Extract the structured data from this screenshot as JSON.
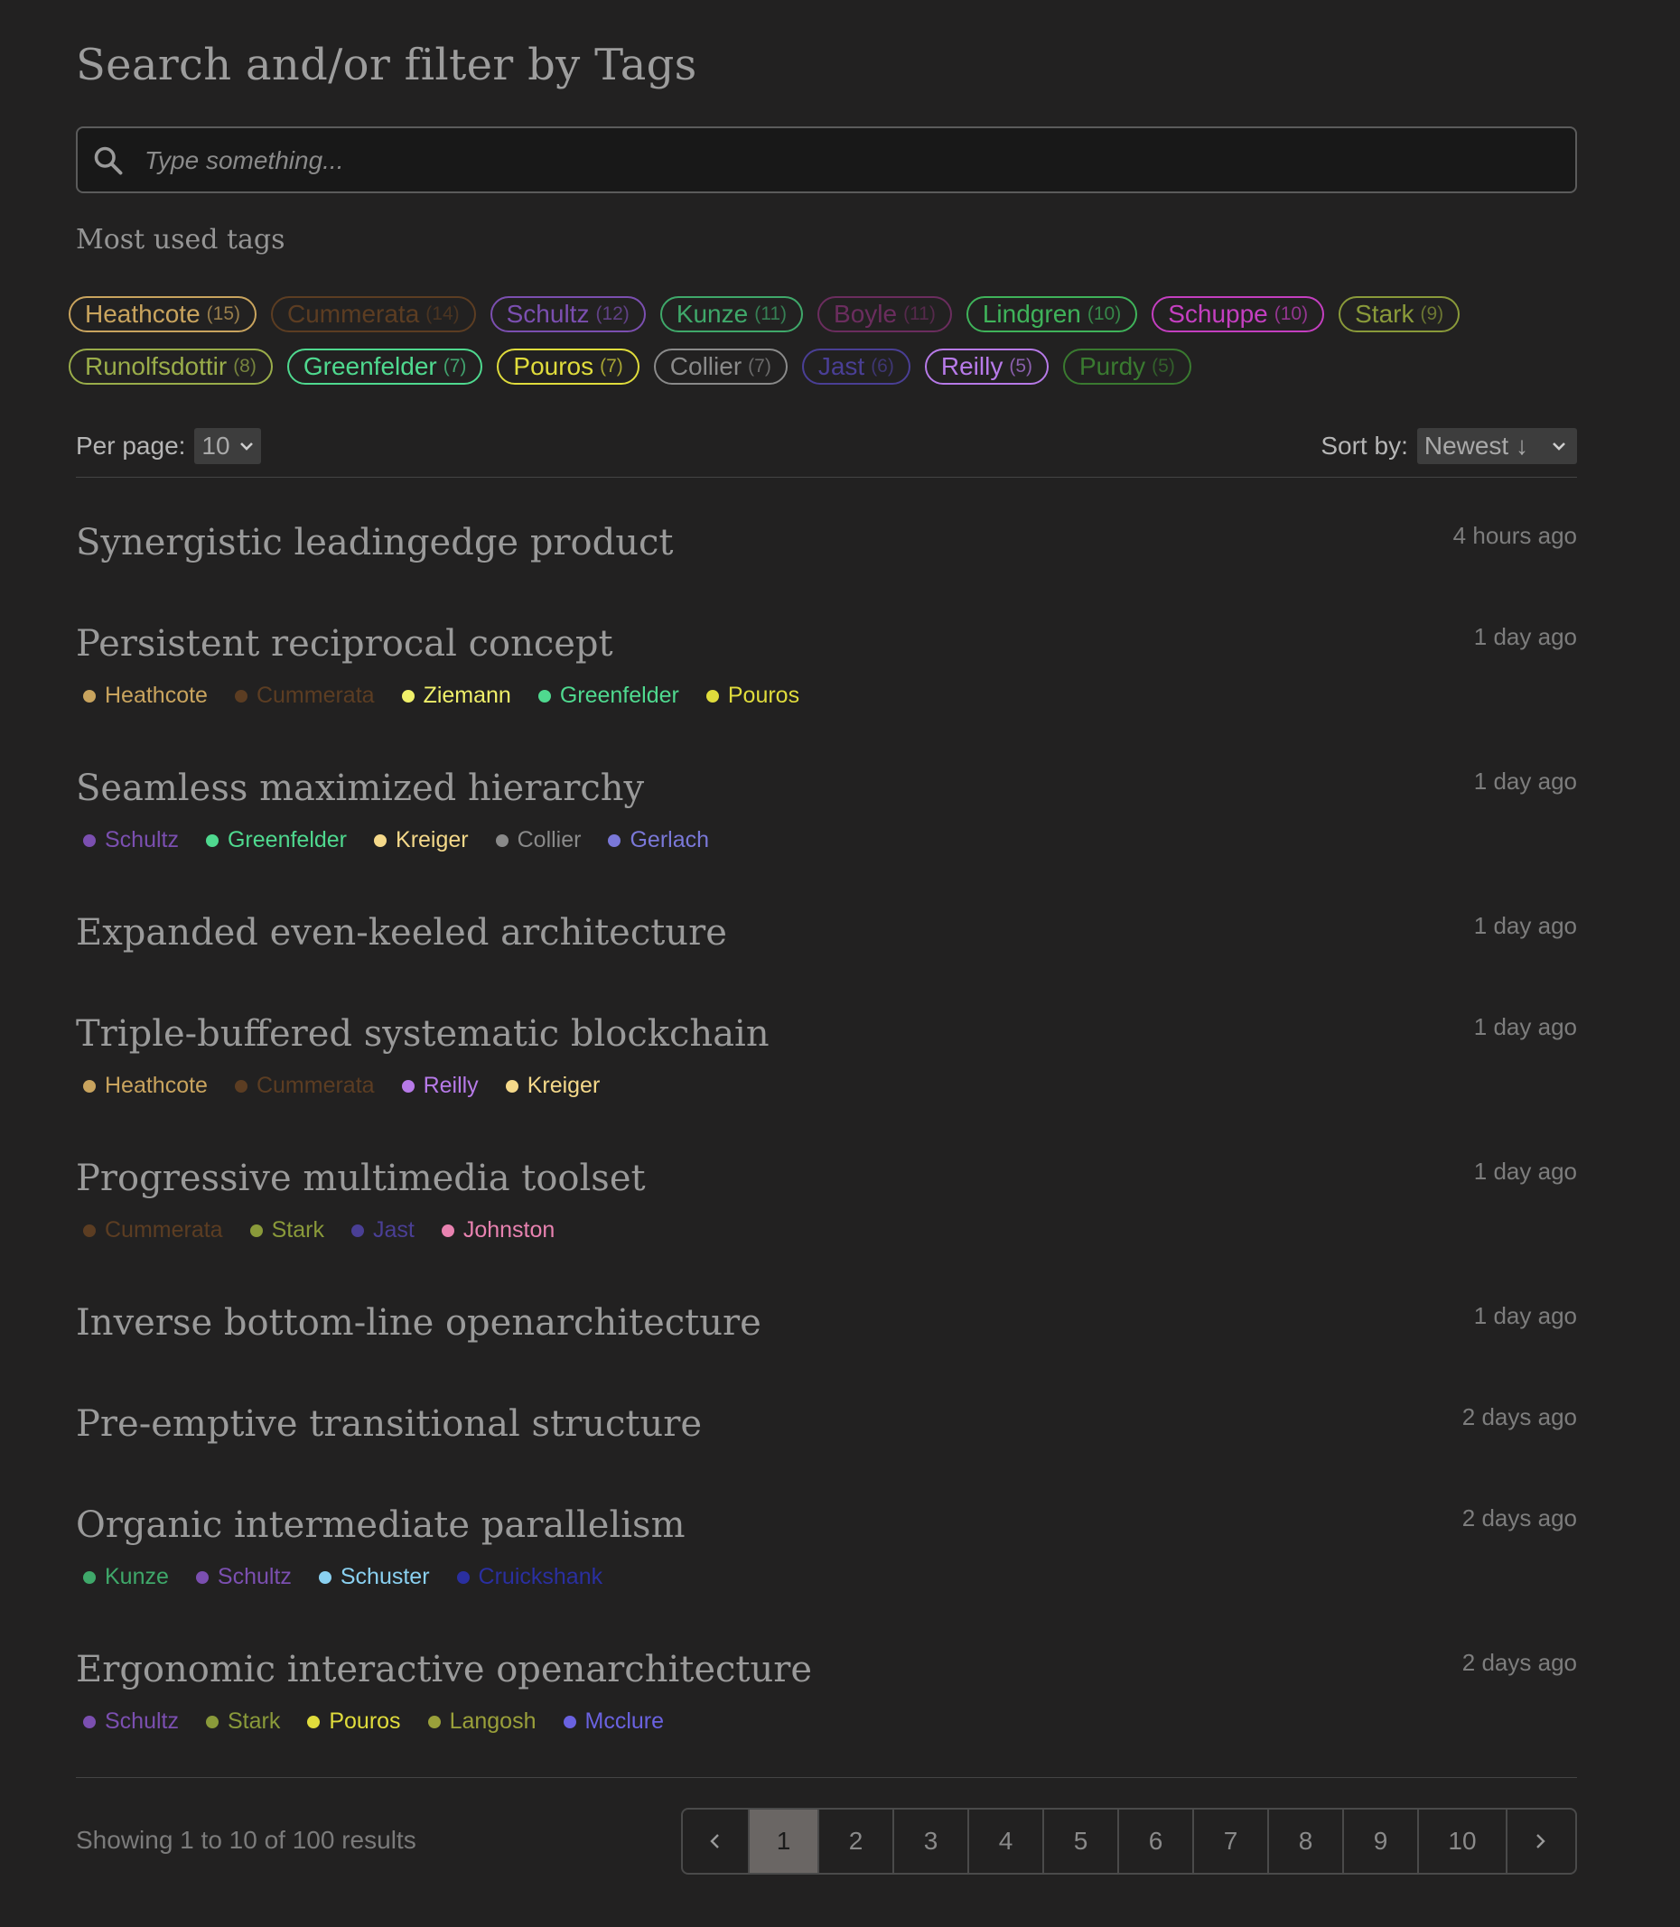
{
  "header": {
    "title": "Search and/or filter by Tags"
  },
  "search": {
    "placeholder": "Type something..."
  },
  "tags_section": {
    "label": "Most used tags",
    "rows": [
      [
        {
          "name": "Heathcote",
          "count": "(15)",
          "color": "#c9a45e"
        },
        {
          "name": "Cummerata",
          "count": "(14)",
          "color": "#5c3d22"
        },
        {
          "name": "Schultz",
          "count": "(12)",
          "color": "#7b4fb0"
        },
        {
          "name": "Kunze",
          "count": "(11)",
          "color": "#3fa86a"
        },
        {
          "name": "Boyle",
          "count": "(11)",
          "color": "#6b2d5e"
        },
        {
          "name": "Lindgren",
          "count": "(10)",
          "color": "#3fb35a"
        },
        {
          "name": "Schuppe",
          "count": "(10)",
          "color": "#c43fc0"
        },
        {
          "name": "Stark",
          "count": "(9)",
          "color": "#8a9a3a"
        }
      ],
      [
        {
          "name": "Runolfsdottir",
          "count": "(8)",
          "color": "#9aad4a"
        },
        {
          "name": "Greenfelder",
          "count": "(7)",
          "color": "#4fd98f"
        },
        {
          "name": "Pouros",
          "count": "(7)",
          "color": "#e0dc3c"
        },
        {
          "name": "Collier",
          "count": "(7)",
          "color": "#8a8a8a"
        },
        {
          "name": "Jast",
          "count": "(6)",
          "color": "#4a3f95"
        },
        {
          "name": "Reilly",
          "count": "(5)",
          "color": "#b77ae8"
        },
        {
          "name": "Purdy",
          "count": "(5)",
          "color": "#3a7a30"
        }
      ]
    ]
  },
  "controls": {
    "per_page_label": "Per page:",
    "per_page_value": "10",
    "sort_label": "Sort by:",
    "sort_value": "Newest ↓"
  },
  "posts": [
    {
      "title": "Synergistic leadingedge product",
      "time": "4 hours ago",
      "tags": []
    },
    {
      "title": "Persistent reciprocal concept",
      "time": "1 day ago",
      "tags": [
        {
          "name": "Heathcote",
          "color": "#c9a45e"
        },
        {
          "name": "Cummerata",
          "color": "#5c3d22"
        },
        {
          "name": "Ziemann",
          "color": "#f0f06a"
        },
        {
          "name": "Greenfelder",
          "color": "#4fd98f"
        },
        {
          "name": "Pouros",
          "color": "#e0dc3c"
        }
      ]
    },
    {
      "title": "Seamless maximized hierarchy",
      "time": "1 day ago",
      "tags": [
        {
          "name": "Schultz",
          "color": "#7b4fb0"
        },
        {
          "name": "Greenfelder",
          "color": "#4fd98f"
        },
        {
          "name": "Kreiger",
          "color": "#f5d98a"
        },
        {
          "name": "Collier",
          "color": "#8a8a8a"
        },
        {
          "name": "Gerlach",
          "color": "#7a78d8"
        }
      ]
    },
    {
      "title": "Expanded even-keeled architecture",
      "time": "1 day ago",
      "tags": []
    },
    {
      "title": "Triple-buffered systematic blockchain",
      "time": "1 day ago",
      "tags": [
        {
          "name": "Heathcote",
          "color": "#c9a45e"
        },
        {
          "name": "Cummerata",
          "color": "#5c3d22"
        },
        {
          "name": "Reilly",
          "color": "#b77ae8"
        },
        {
          "name": "Kreiger",
          "color": "#f5d98a"
        }
      ]
    },
    {
      "title": "Progressive multimedia toolset",
      "time": "1 day ago",
      "tags": [
        {
          "name": "Cummerata",
          "color": "#5c3d22"
        },
        {
          "name": "Stark",
          "color": "#8a9a3a"
        },
        {
          "name": "Jast",
          "color": "#4a3f95"
        },
        {
          "name": "Johnston",
          "color": "#e882b0"
        }
      ]
    },
    {
      "title": "Inverse bottom-line openarchitecture",
      "time": "1 day ago",
      "tags": []
    },
    {
      "title": "Pre-emptive transitional structure",
      "time": "2 days ago",
      "tags": []
    },
    {
      "title": "Organic intermediate parallelism",
      "time": "2 days ago",
      "tags": [
        {
          "name": "Kunze",
          "color": "#3fa86a"
        },
        {
          "name": "Schultz",
          "color": "#7b4fb0"
        },
        {
          "name": "Schuster",
          "color": "#8ad0f0"
        },
        {
          "name": "Cruickshank",
          "color": "#2a2fa0"
        }
      ]
    },
    {
      "title": "Ergonomic interactive openarchitecture",
      "time": "2 days ago",
      "tags": [
        {
          "name": "Schultz",
          "color": "#7b4fb0"
        },
        {
          "name": "Stark",
          "color": "#8a9a3a"
        },
        {
          "name": "Pouros",
          "color": "#e0dc3c"
        },
        {
          "name": "Langosh",
          "color": "#9aa03a"
        },
        {
          "name": "Mcclure",
          "color": "#6a62e0"
        }
      ]
    }
  ],
  "footer": {
    "results_text": "Showing 1 to 10 of 100 results",
    "pages": [
      "1",
      "2",
      "3",
      "4",
      "5",
      "6",
      "7",
      "8",
      "9",
      "10"
    ],
    "active_page": "1",
    "prev_icon": "chevron-left-icon",
    "next_icon": "chevron-right-icon"
  }
}
